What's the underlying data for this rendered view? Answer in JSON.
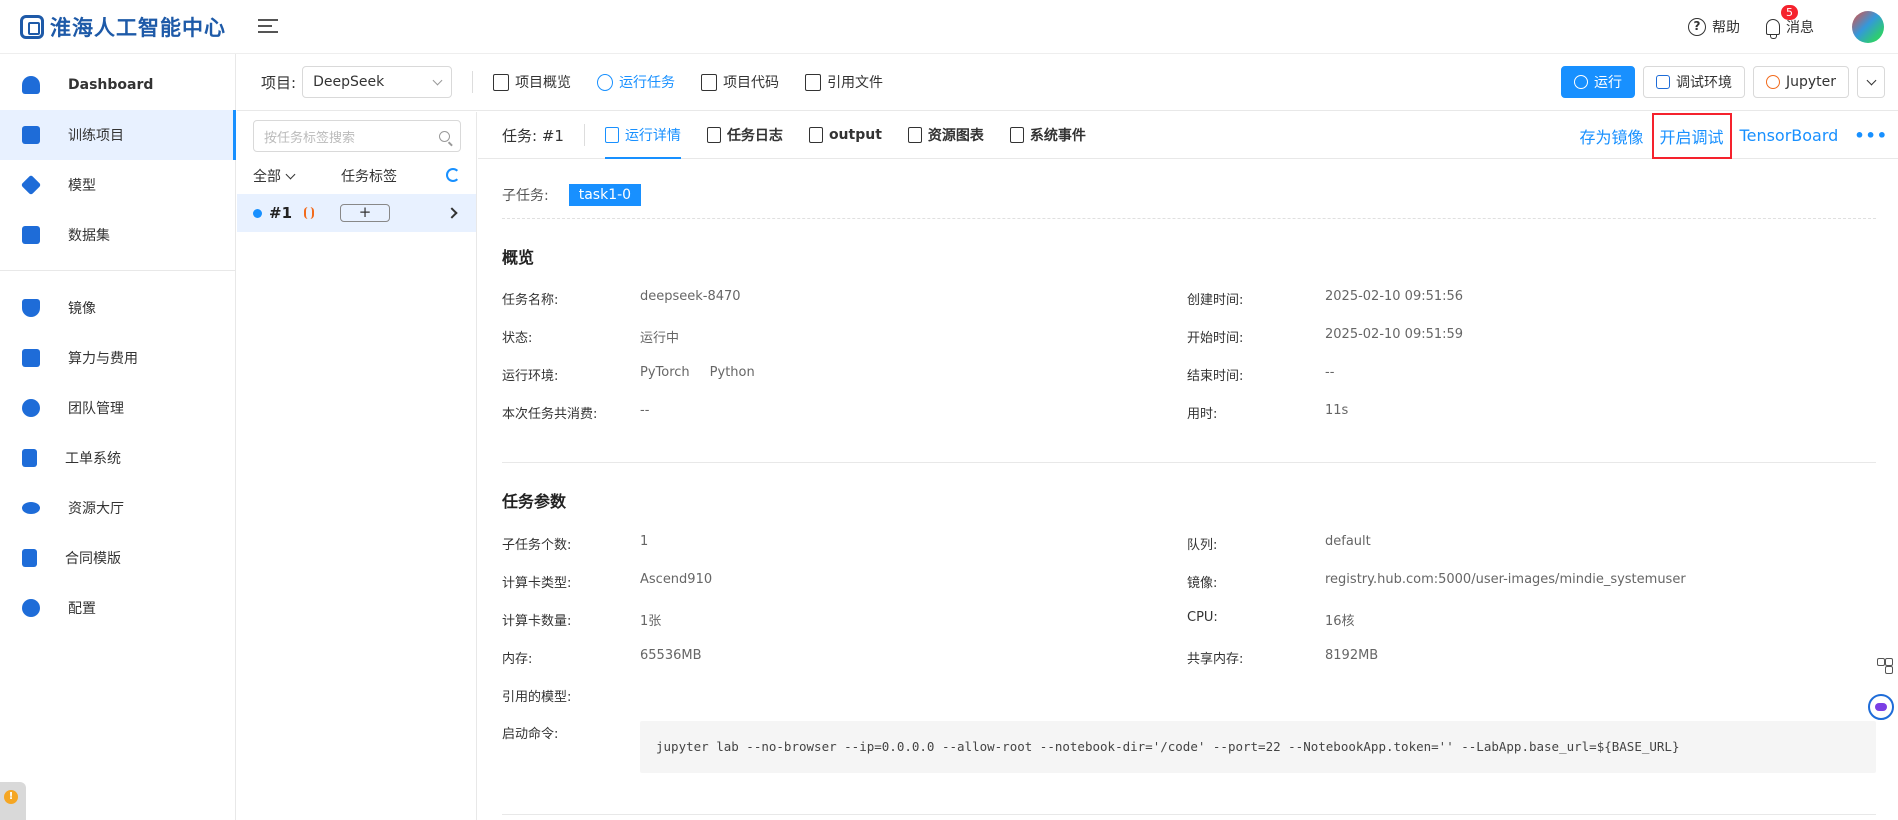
{
  "app": {
    "logo_text": "淮海人工智能中心"
  },
  "header": {
    "help_label": "帮助",
    "messages_label": "消息",
    "messages_badge": "5"
  },
  "sidebar": {
    "items": [
      {
        "label": "Dashboard",
        "icon": "user-icon",
        "active": false
      },
      {
        "label": "训练项目",
        "icon": "server-icon",
        "active": true
      },
      {
        "label": "模型",
        "icon": "cube-icon",
        "active": false
      },
      {
        "label": "数据集",
        "icon": "layers-icon",
        "active": false
      },
      {
        "label": "镜像",
        "icon": "shield-icon",
        "active": false
      },
      {
        "label": "算力与费用",
        "icon": "compute-cost-icon",
        "active": false
      },
      {
        "label": "团队管理",
        "icon": "team-icon",
        "active": false
      },
      {
        "label": "工单系统",
        "icon": "ticket-icon",
        "active": false
      },
      {
        "label": "资源大厅",
        "icon": "eye-icon",
        "active": false
      },
      {
        "label": "合同模版",
        "icon": "contract-icon",
        "active": false
      },
      {
        "label": "配置",
        "icon": "gear-icon",
        "active": false
      }
    ]
  },
  "project": {
    "label": "项目:",
    "selected": "DeepSeek",
    "tabs": [
      {
        "label": "项目概览",
        "active": false
      },
      {
        "label": "运行任务",
        "active": true
      },
      {
        "label": "项目代码",
        "active": false
      },
      {
        "label": "引用文件",
        "active": false
      }
    ],
    "actions": {
      "run": "运行",
      "debug_env": "调试环境",
      "jupyter": "Jupyter"
    }
  },
  "tasklist": {
    "search_placeholder": "按任务标签搜索",
    "filter_all": "全部",
    "tag_header": "任务标签",
    "rows": [
      {
        "id": "#1",
        "add_label": "+"
      }
    ]
  },
  "detail": {
    "task_title": "任务: #1",
    "tabs": [
      {
        "label": "运行详情",
        "active": true
      },
      {
        "label": "任务日志",
        "active": false
      },
      {
        "label": "output",
        "active": false
      },
      {
        "label": "资源图表",
        "active": false
      },
      {
        "label": "系统事件",
        "active": false
      }
    ],
    "actions": {
      "save_image": "存为镜像",
      "start_debug": "开启调试",
      "tensorboard": "TensorBoard",
      "more": "•••"
    },
    "subtask_label": "子任务:",
    "subtask_tag": "task1-0",
    "overview": {
      "title": "概览",
      "name_k": "任务名称:",
      "name_v": "deepseek-8470",
      "status_k": "状态:",
      "status_v": "运行中",
      "env_k": "运行环境:",
      "env_v1": "PyTorch",
      "env_v2": "Python",
      "cost_k": "本次任务共消费:",
      "cost_v": "--",
      "created_k": "创建时间:",
      "created_v": "2025-02-10 09:51:56",
      "started_k": "开始时间:",
      "started_v": "2025-02-10 09:51:59",
      "ended_k": "结束时间:",
      "ended_v": "--",
      "duration_k": "用时:",
      "duration_v": "11s"
    },
    "params": {
      "title": "任务参数",
      "subtasks_k": "子任务个数:",
      "subtasks_v": "1",
      "cardtype_k": "计算卡类型:",
      "cardtype_v": "Ascend910",
      "cardcount_k": "计算卡数量:",
      "cardcount_v": "1张",
      "mem_k": "内存:",
      "mem_v": "65536MB",
      "model_k": "引用的模型:",
      "cmd_k": "启动命令:",
      "queue_k": "队列:",
      "queue_v": "default",
      "image_k": "镜像:",
      "image_v": "registry.hub.com:5000/user-images/mindie_systemuser",
      "cpu_k": "CPU:",
      "cpu_v": "16核",
      "shm_k": "共享内存:",
      "shm_v": "8192MB",
      "command": "jupyter lab --no-browser --ip=0.0.0.0 --allow-root --notebook-dir='/code' --port=22 --NotebookApp.token='' --LabApp.base_url=${BASE_URL}"
    }
  },
  "colors": {
    "accent": "#1890ff",
    "highlight": "#f5222d",
    "logo": "#1e5aa8"
  }
}
